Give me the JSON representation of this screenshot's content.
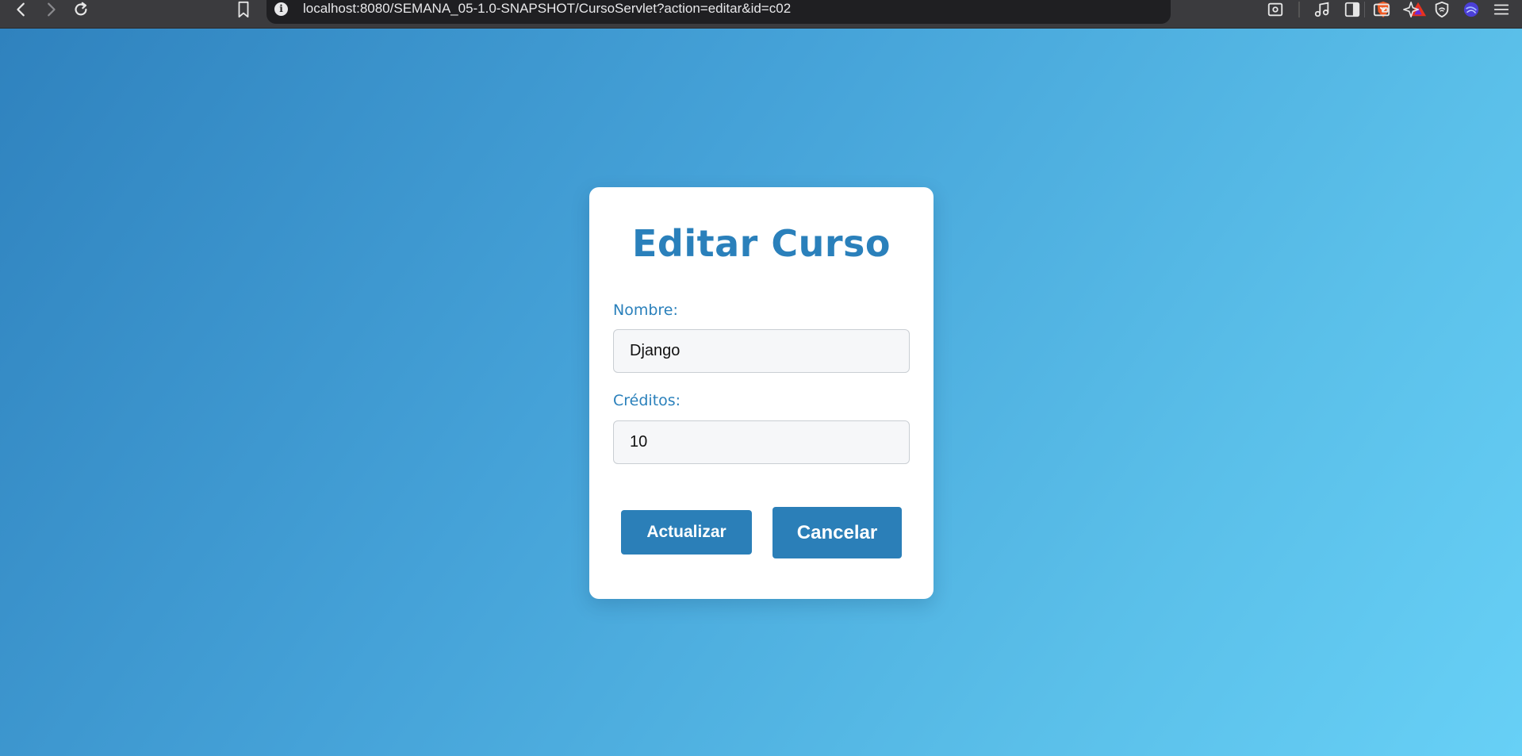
{
  "browser": {
    "url": "localhost:8080/SEMANA_05-1.0-SNAPSHOT/CursoServlet?action=editar&id=c02",
    "info_icon_glyph": "i",
    "icons": [
      "back-icon",
      "forward-icon",
      "reload-icon",
      "bookmark-icon",
      "info-icon",
      "brave-shield-icon",
      "brave-rewards-icon",
      "screenshot-icon",
      "music-icon",
      "sidebar-icon",
      "wallet-icon",
      "leo-ai-icon",
      "vpn-icon",
      "profile-icon",
      "menu-icon"
    ]
  },
  "form": {
    "title": "Editar Curso",
    "nombre_label": "Nombre:",
    "nombre_value": "Django",
    "creditos_label": "Créditos:",
    "creditos_value": "10",
    "update_button": "Actualizar",
    "cancel_button": "Cancelar"
  },
  "colors": {
    "accent": "#2a80bb",
    "button": "#2b7fb8",
    "background_start": "#2f82be",
    "background_end": "#67d0f6"
  }
}
